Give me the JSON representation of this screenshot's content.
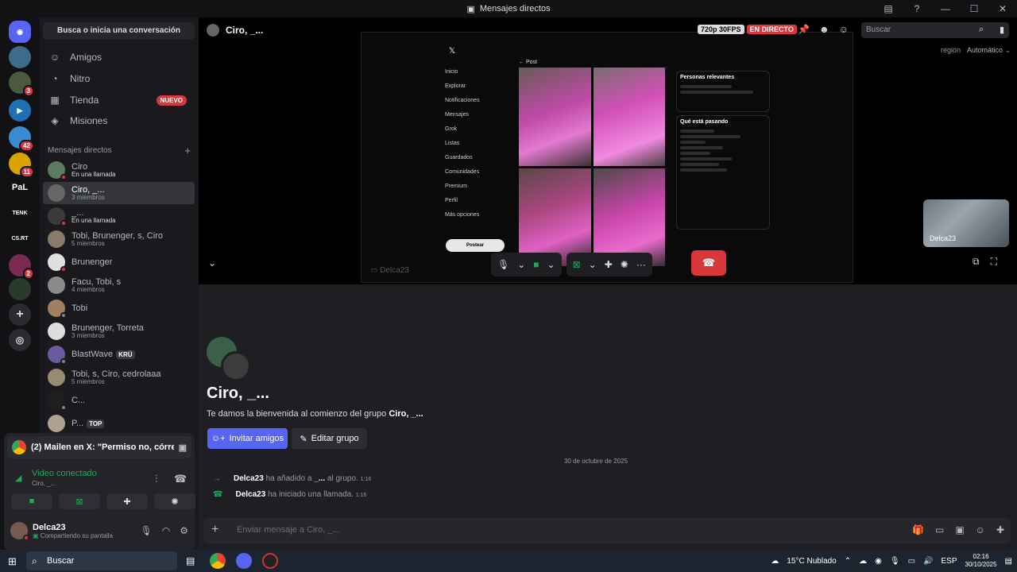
{
  "window": {
    "title": "Mensajes directos"
  },
  "dm_panel": {
    "search": "Busca o inicia una conversación",
    "nav": [
      {
        "label": "Amigos",
        "icon": "friends-icon"
      },
      {
        "label": "Nitro",
        "icon": "nitro-icon"
      },
      {
        "label": "Tienda",
        "icon": "shop-icon",
        "badge": "NUEVO"
      },
      {
        "label": "Misiones",
        "icon": "quests-icon"
      }
    ],
    "section_header": "Mensajes directos",
    "dms": [
      {
        "name": "Ciro",
        "sub": "En una llamada"
      },
      {
        "name": "Ciro, _...",
        "sub": "3 miembros"
      },
      {
        "name": "_...",
        "sub": "En una llamada"
      },
      {
        "name": "Tobi, Brunenger, s, Ciro",
        "sub": "5 miembros"
      },
      {
        "name": "Brunenger",
        "sub": ""
      },
      {
        "name": "Facu, Tobi, s",
        "sub": "4 miembros"
      },
      {
        "name": "Tobi",
        "sub": ""
      },
      {
        "name": "Brunenger, Torreta",
        "sub": "3 miembros"
      },
      {
        "name": "BlastWave",
        "sub": "",
        "tag": "KRÜ"
      },
      {
        "name": "Tobi, s, Ciro, cedrolaaa",
        "sub": "5 miembros"
      },
      {
        "name": "C...",
        "sub": ""
      },
      {
        "name": "P...",
        "sub": "",
        "tag": "TOP"
      }
    ]
  },
  "servers": {
    "badges": [
      "3",
      "42",
      "11",
      "2"
    ],
    "labels": [
      "PaL",
      "TENK",
      "CS.RT"
    ]
  },
  "voice": {
    "notification": "(2) Mailen en X: \"Permiso no, córret...",
    "status": "Video conectado",
    "channel": "Ciro, _..."
  },
  "user": {
    "name": "Delca23",
    "status": "Compartiendo su pantalla"
  },
  "call": {
    "title": "Ciro, _...",
    "quality": "720p 30FPS",
    "live": "EN DIRECTO",
    "search_placeholder": "Buscar",
    "region_label": "región",
    "region_value": "Automático",
    "pip_name": "Delca23",
    "bottom_name": "Delca23",
    "screen": {
      "nav": [
        "Inicio",
        "Explorar",
        "Notificaciones",
        "Mensajes",
        "Grok",
        "Listas",
        "Guardados",
        "Comunidades",
        "Premium",
        "Perfil",
        "Más opciones"
      ],
      "post_btn": "Postear",
      "post_header": "Post",
      "relevant": "Personas relevantes",
      "trending": "Qué está pasando"
    }
  },
  "chat": {
    "group_title": "Ciro, _...",
    "welcome_prefix": "Te damos la bienvenida al comienzo del grupo ",
    "welcome_group": "Ciro, _...",
    "invite_btn": "Invitar amigos",
    "edit_btn": "Editar grupo",
    "date": "30 de octubre de 2025",
    "messages": [
      {
        "user": "Delca23",
        "text": "ha añadido a ",
        "target": "_...",
        "suffix": " al grupo.",
        "time": "1:16"
      },
      {
        "user": "Delca23",
        "text": "ha iniciado una llamada.",
        "target": "",
        "suffix": "",
        "time": "1:16"
      }
    ],
    "composer_placeholder": "Enviar mensaje a Ciro, _..."
  },
  "taskbar": {
    "search": "Buscar",
    "weather": "15°C  Nublado",
    "lang": "ESP",
    "time": "02:16",
    "date": "30/10/2025"
  }
}
